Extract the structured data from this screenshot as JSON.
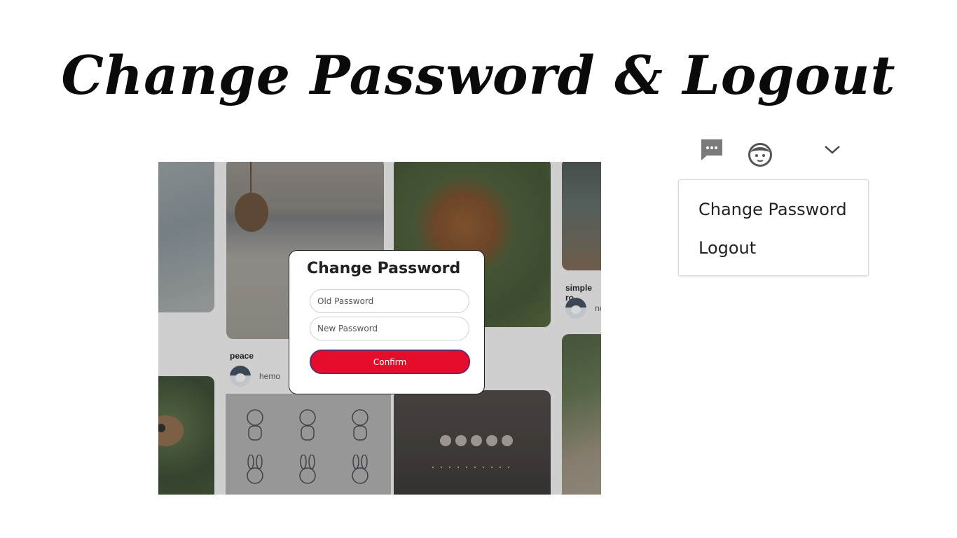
{
  "slide": {
    "title": "Change Password & Logout"
  },
  "feed": {
    "pins": [
      {
        "title": "peace",
        "author": "hemo"
      },
      {
        "title": "simple ro",
        "author": "ne"
      }
    ]
  },
  "modal": {
    "title": "Change Password",
    "old_password_placeholder": "Old Password",
    "new_password_placeholder": "New Password",
    "confirm_label": "Confirm"
  },
  "header": {
    "icons": [
      "messages-icon",
      "profile-icon",
      "chevron-down-icon"
    ]
  },
  "dropdown": {
    "items": [
      {
        "label": "Change Password"
      },
      {
        "label": "Logout"
      }
    ]
  },
  "colors": {
    "confirm_button": "#e50d2b",
    "confirm_border": "#6b2a6a",
    "icon_gray": "#7a7a7a"
  }
}
